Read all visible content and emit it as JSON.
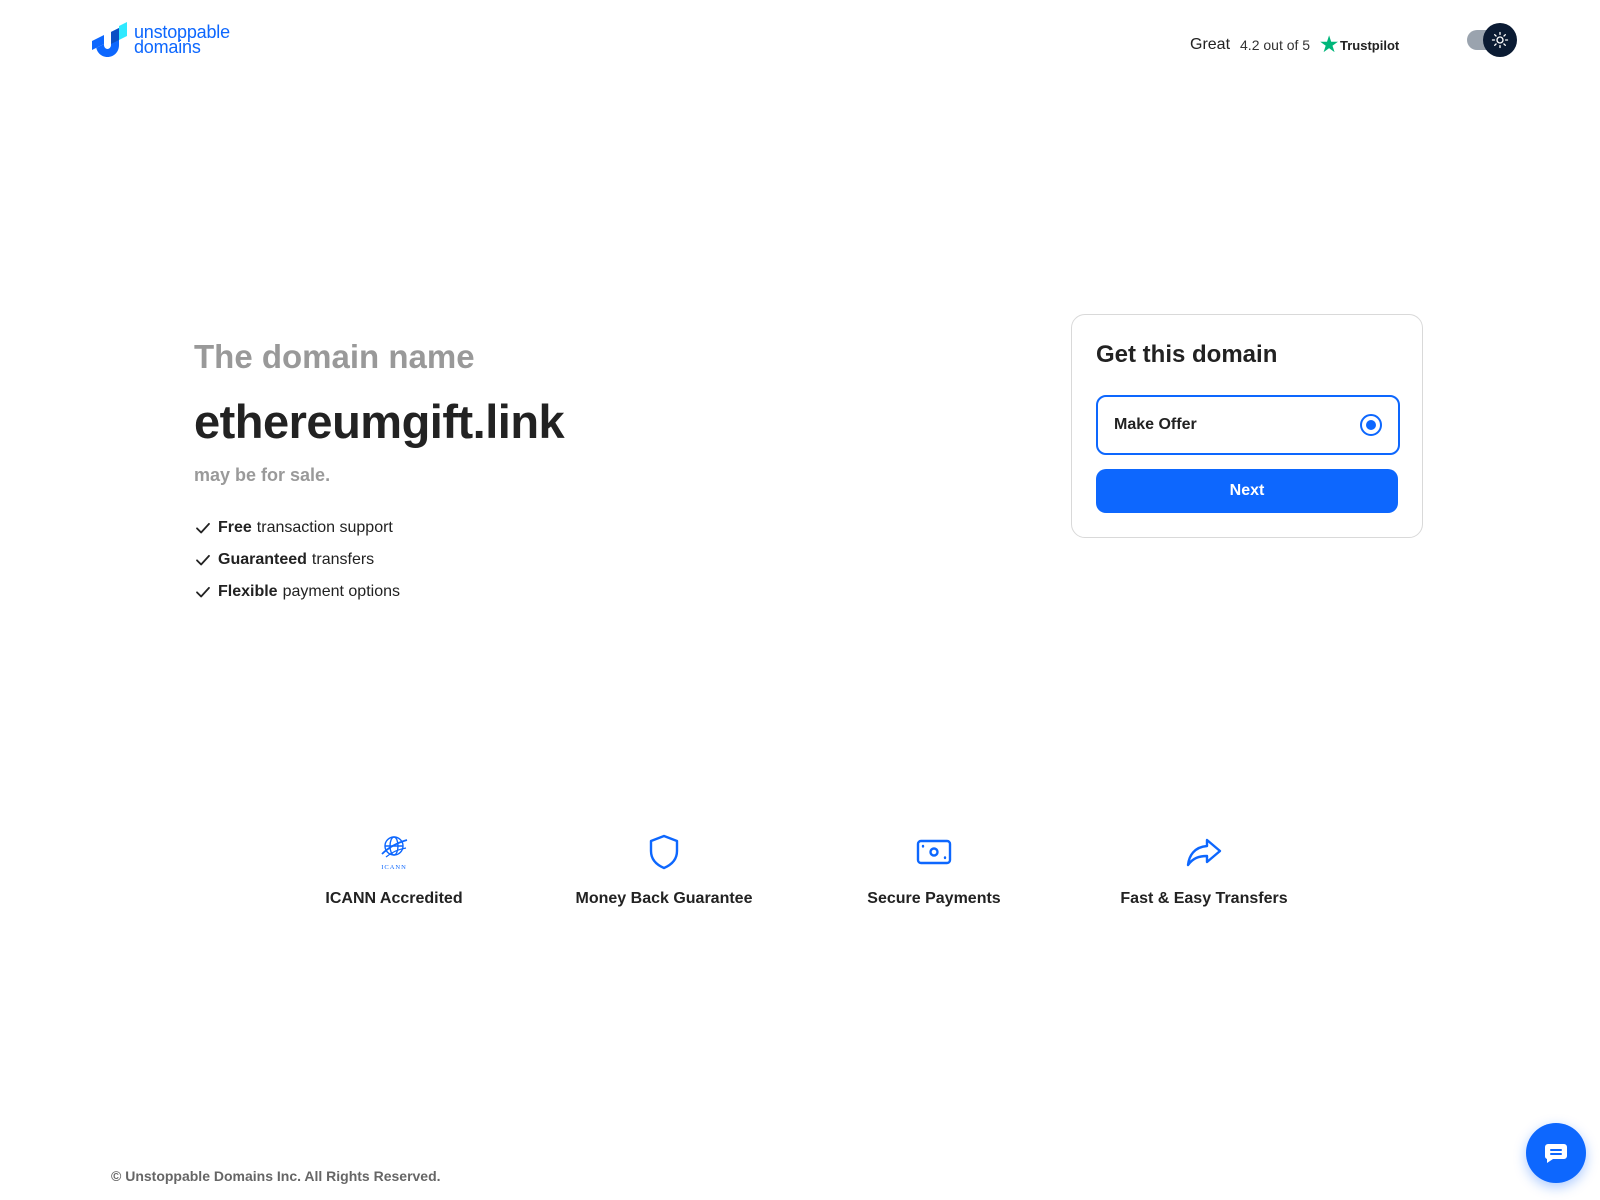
{
  "brand": {
    "line1": "unstoppable",
    "line2": "domains",
    "color": "#0d67fe"
  },
  "trustpilot": {
    "rating_word": "Great",
    "score_text": "4.2 out of 5",
    "brand_name": "Trustpilot",
    "star_color": "#00b67a"
  },
  "theme_toggle": {
    "icon": "sun-icon"
  },
  "hero": {
    "intro": "The domain name",
    "domain": "ethereumgift.link",
    "availability": "may be for sale.",
    "features": [
      {
        "bold": "Free",
        "rest": "transaction support"
      },
      {
        "bold": "Guaranteed",
        "rest": "transfers"
      },
      {
        "bold": "Flexible",
        "rest": "payment options"
      }
    ]
  },
  "offer_card": {
    "title": "Get this domain",
    "option_label": "Make Offer",
    "option_selected": true,
    "next_label": "Next"
  },
  "badges": [
    {
      "label": "ICANN Accredited",
      "icon": "icann-logo-icon",
      "icon_text": "ICANN"
    },
    {
      "label": "Money Back Guarantee",
      "icon": "shield-icon"
    },
    {
      "label": "Secure Payments",
      "icon": "money-icon"
    },
    {
      "label": "Fast & Easy Transfers",
      "icon": "share-arrow-icon"
    }
  ],
  "footer": {
    "copyright": "© Unstoppable Domains Inc. All Rights Reserved."
  },
  "chat": {
    "icon": "chat-icon"
  }
}
